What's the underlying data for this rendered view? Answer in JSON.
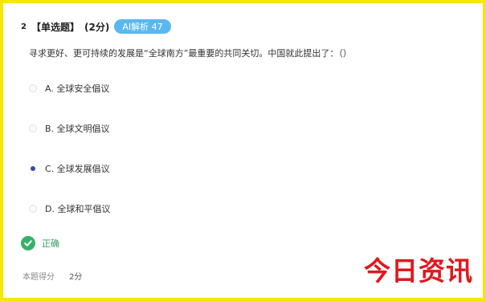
{
  "question": {
    "number": "2",
    "type_label": "【单选题】",
    "points_label": "(2分)",
    "tag_label": "AI解析 47",
    "stem": "寻求更好、更可持续的发展是“全球南方”最重要的共同关切。中国就此提出了：（）",
    "options": [
      {
        "label": "A. 全球安全倡议",
        "selected": false
      },
      {
        "label": "B. 全球文明倡议",
        "selected": false
      },
      {
        "label": "C. 全球发展倡议",
        "selected": true
      },
      {
        "label": "D. 全球和平倡议",
        "selected": false
      }
    ]
  },
  "result": {
    "status_label": "正确",
    "icon": "check-circle-icon"
  },
  "score": {
    "label": "本题得分",
    "value": "2分"
  },
  "watermark": {
    "text": "今日资讯"
  },
  "colors": {
    "frame": "#f7e600",
    "tag": "#5ab8ee",
    "selected": "#3b4aa0",
    "correct": "#36b26b",
    "watermark": "#e0181f"
  }
}
